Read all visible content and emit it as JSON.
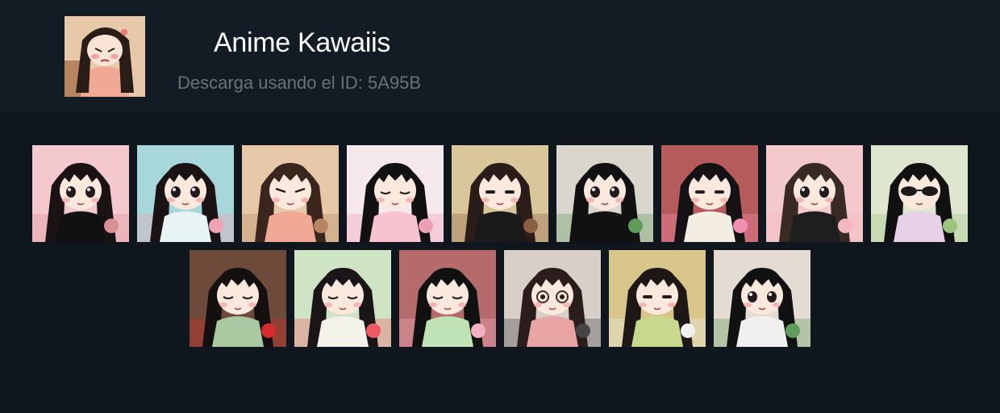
{
  "header": {
    "title": "Anime Kawaiis",
    "subtitle_prefix": "Descarga usando el ID:",
    "pack_id": "5A95B"
  },
  "stickers": [
    {
      "name": "girl-sad-eyes",
      "bg": "#f3c9cf",
      "shirt": "#111111",
      "hair": "#1b1214",
      "blush": true,
      "eyes": "big",
      "accent": "#d98f96"
    },
    {
      "name": "girl-bubbles",
      "bg": "#a7d7db",
      "shirt": "#e8f3f5",
      "hair": "#1b1214",
      "blush": true,
      "eyes": "big",
      "accent": "#f2a2b5"
    },
    {
      "name": "girl-pouting",
      "bg": "#e7c9a9",
      "shirt": "#f1a895",
      "hair": "#3a261d",
      "blush": true,
      "eyes": "angry",
      "accent": "#b78560"
    },
    {
      "name": "girl-laughing",
      "bg": "#f6e9ee",
      "shirt": "#f7c3cf",
      "hair": "#111111",
      "blush": true,
      "eyes": "closed",
      "accent": "#ee9fb5"
    },
    {
      "name": "girl-with-cat-sleepy",
      "bg": "#d9c69a",
      "shirt": "#1a1a1a",
      "hair": "#2a1d19",
      "blush": true,
      "eyes": "half",
      "accent": "#8a5f43"
    },
    {
      "name": "girl-with-bottle",
      "bg": "#d9d6cd",
      "shirt": "#111111",
      "hair": "#111111",
      "blush": true,
      "eyes": "big",
      "accent": "#5f9c5a"
    },
    {
      "name": "girl-flowers-tired",
      "bg": "#b65b5b",
      "shirt": "#f4ede1",
      "hair": "#141214",
      "blush": true,
      "eyes": "half",
      "accent": "#f08fb0"
    },
    {
      "name": "girl-pink-hood",
      "bg": "#f4c9cd",
      "shirt": "#1e1e1e",
      "hair": "#3a2a25",
      "blush": true,
      "eyes": "big",
      "accent": "#f3b7bf"
    },
    {
      "name": "girl-sunglasses",
      "bg": "#dfe6d0",
      "shirt": "#e6d1e8",
      "hair": "#111111",
      "blush": false,
      "eyes": "glasses",
      "accent": "#9cc47e"
    },
    {
      "name": "girl-red-roses",
      "bg": "#6d4a3a",
      "shirt": "#a9c9a3",
      "hair": "#141010",
      "blush": true,
      "eyes": "closed",
      "accent": "#d62b2b"
    },
    {
      "name": "girl-meditating",
      "bg": "#cfe3c5",
      "shirt": "#f2f2ea",
      "hair": "#1a1517",
      "blush": true,
      "eyes": "closed",
      "accent": "#ee5a64"
    },
    {
      "name": "girl-surprised",
      "bg": "#b56b6b",
      "shirt": "#bfe2b7",
      "hair": "#111111",
      "blush": true,
      "eyes": "closed",
      "accent": "#f3b0c0"
    },
    {
      "name": "girl-glasses-computer",
      "bg": "#d8cfc9",
      "shirt": "#e8a3a3",
      "hair": "#2a1d1b",
      "blush": true,
      "eyes": "glasses-round",
      "accent": "#444444"
    },
    {
      "name": "girl-holding-cat",
      "bg": "#d7c58a",
      "shirt": "#c8d98d",
      "hair": "#1d1715",
      "blush": true,
      "eyes": "half",
      "accent": "#f0f0f0"
    },
    {
      "name": "girl-bow-bottle",
      "bg": "#e4dbd2",
      "shirt": "#f0f0f0",
      "hair": "#111111",
      "blush": true,
      "eyes": "big",
      "accent": "#5f9c5a"
    }
  ]
}
